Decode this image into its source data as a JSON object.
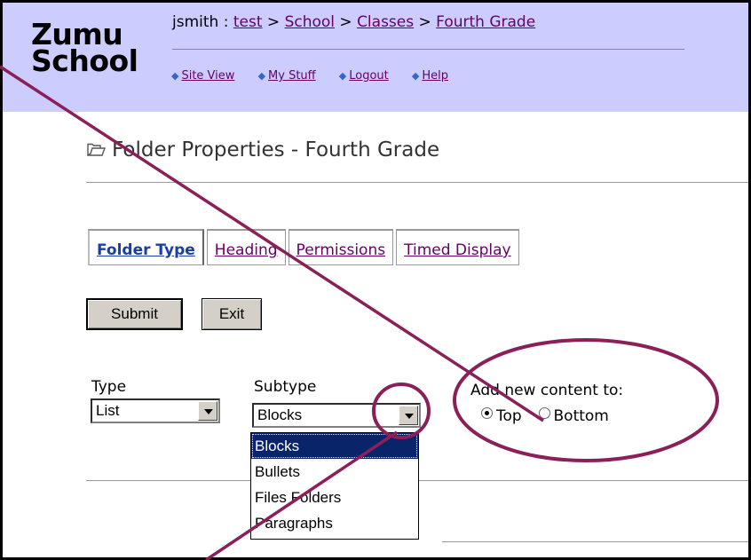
{
  "app": {
    "logo_line1": "Zumu",
    "logo_line2": "School"
  },
  "breadcrumb": {
    "user_prefix": "jsmith : ",
    "items": [
      "test",
      "School",
      "Classes",
      "Fourth Grade"
    ],
    "separator": " > "
  },
  "nav": {
    "items": [
      "Site View",
      "My Stuff",
      "Logout",
      "Help"
    ]
  },
  "page": {
    "title": "Folder Properties - Fourth Grade"
  },
  "tabs": [
    {
      "label": "Folder Type",
      "active": true
    },
    {
      "label": "Heading",
      "active": false
    },
    {
      "label": "Permissions",
      "active": false
    },
    {
      "label": "Timed Display",
      "active": false
    }
  ],
  "buttons": {
    "submit": "Submit",
    "exit": "Exit"
  },
  "form": {
    "type_label": "Type",
    "type_value": "List",
    "subtype_label": "Subtype",
    "subtype_value": "Blocks",
    "subtype_options": [
      "Blocks",
      "Bullets",
      "Files Folders",
      "Paragraphs"
    ],
    "add_content_label": "Add new content to:",
    "position_options": [
      {
        "label": "Top",
        "checked": true
      },
      {
        "label": "Bottom",
        "checked": false
      }
    ]
  },
  "colors": {
    "header_bg": "#ccccff",
    "link": "#660066",
    "annotation": "#8b2058",
    "selection": "#0a246a"
  }
}
